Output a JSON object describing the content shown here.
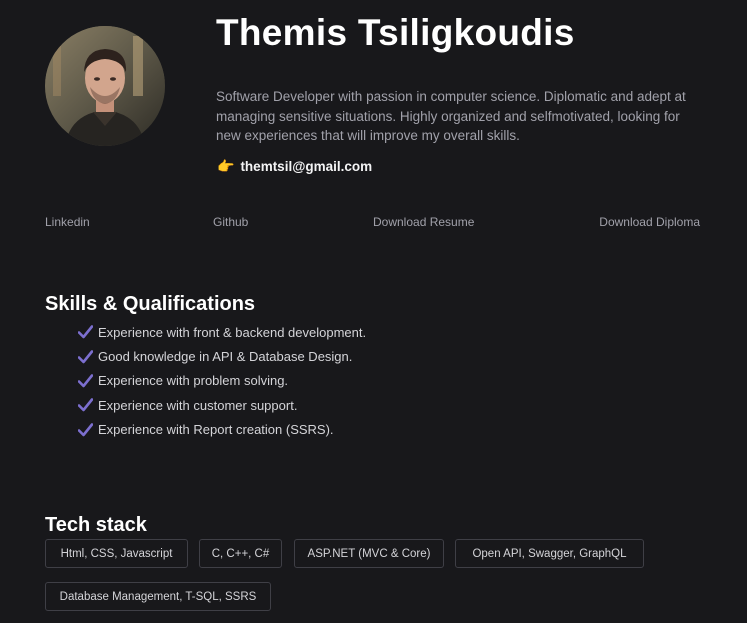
{
  "profile": {
    "name": "Themis Tsiligkoudis",
    "bio": "Software Developer with passion in computer science. Diplomatic and adept at managing sensitive situations. Highly organized and selfmotivated, looking for new experiences that will improve my overall skills.",
    "email_icon": "pointing-hand-icon",
    "email": "themtsil@gmail.com"
  },
  "links": {
    "linkedin": "Linkedin",
    "github": "Github",
    "resume": "Download Resume",
    "diploma": "Download Diploma"
  },
  "skills": {
    "title": "Skills & Qualifications",
    "items": [
      "Experience with front & backend development.",
      "Good knowledge in API & Database Design.",
      "Experience with problem solving.",
      "Experience with customer support.",
      "Experience with Report creation (SSRS)."
    ],
    "check_icon": "check-icon",
    "check_color": "#7c6fcf"
  },
  "tech": {
    "title": "Tech stack",
    "chips": [
      "Html, CSS, Javascript",
      "C, C++, C#",
      "ASP.NET (MVC & Core)",
      "Open API, Swagger, GraphQL",
      "Database Management, T-SQL, SSRS"
    ]
  },
  "colors": {
    "background": "#18181b",
    "heading": "#ffffff",
    "muted_text": "#a1a1aa",
    "chip_border": "#3f3f46"
  }
}
